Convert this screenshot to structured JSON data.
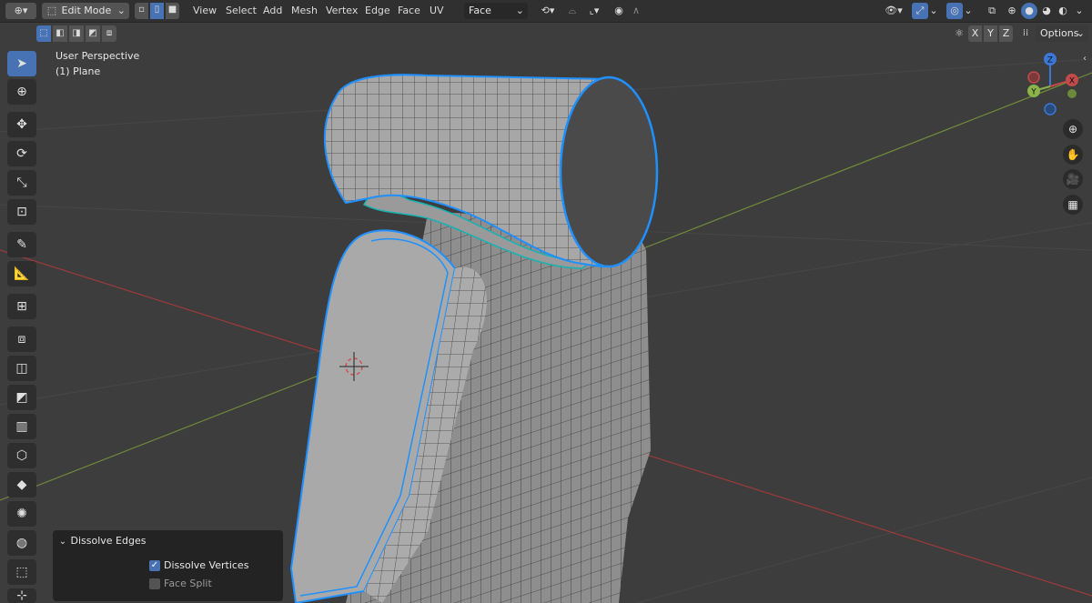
{
  "header": {
    "mode": "Edit Mode",
    "menus": [
      "View",
      "Select",
      "Add",
      "Mesh",
      "Vertex",
      "Edge",
      "Face",
      "UV"
    ],
    "orientation": "Face",
    "options_label": "Options",
    "axes": [
      "X",
      "Y",
      "Z"
    ]
  },
  "viewport": {
    "perspective_label": "User Perspective",
    "object_label": "(1) Plane"
  },
  "gizmo": {
    "x": "X",
    "y": "Y",
    "z": "Z"
  },
  "operator_panel": {
    "title": "Dissolve Edges",
    "options": [
      {
        "label": "Dissolve Vertices",
        "checked": true
      },
      {
        "label": "Face Split",
        "checked": false
      }
    ]
  },
  "colors": {
    "accent": "#4772b3",
    "selection": "#1e90ff",
    "x_axis": "#c34a4a",
    "y_axis": "#8ab34a",
    "z_axis": "#3a77d6"
  }
}
